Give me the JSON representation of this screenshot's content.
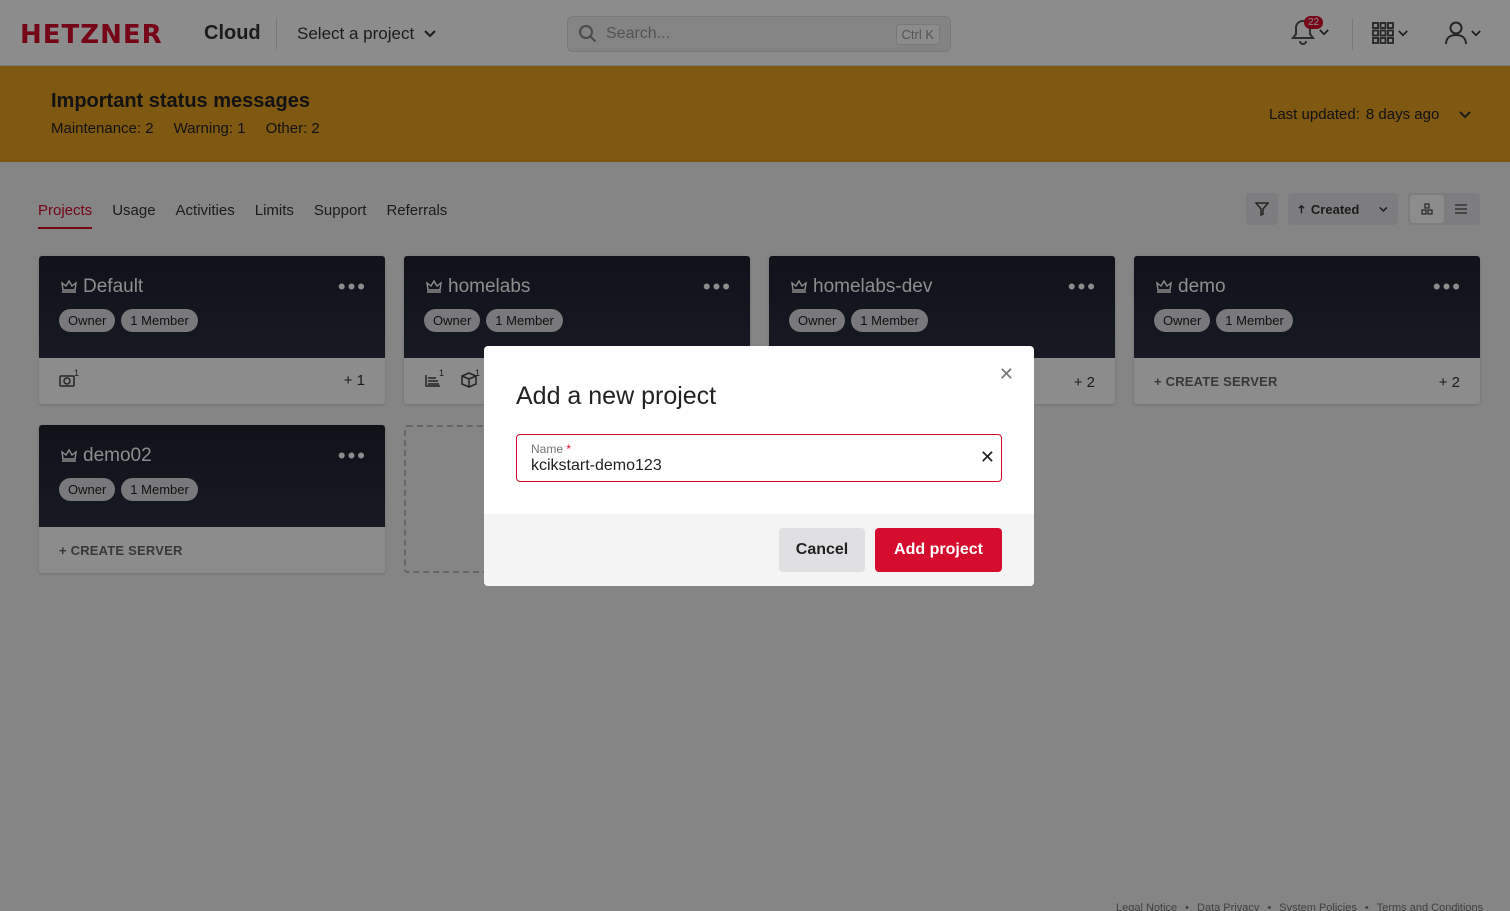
{
  "header": {
    "logo": "HETZNER",
    "product": "Cloud",
    "project_select": "Select a project",
    "search_placeholder": "Search...",
    "search_shortcut": "Ctrl K",
    "notifications_count": "22"
  },
  "banner": {
    "title": "Important status messages",
    "maintenance_label": "Maintenance:",
    "maintenance_value": "2",
    "warning_label": "Warning:",
    "warning_value": "1",
    "other_label": "Other:",
    "other_value": "2",
    "updated_label": "Last updated:",
    "updated_value": "8 days ago"
  },
  "tabs": [
    "Projects",
    "Usage",
    "Activities",
    "Limits",
    "Support",
    "Referrals"
  ],
  "toolbar": {
    "sort_label": "Created"
  },
  "projects": [
    {
      "name": "Default",
      "role": "Owner",
      "members": "1 Member",
      "plus": "+ 1",
      "res1": "1"
    },
    {
      "name": "homelabs",
      "role": "Owner",
      "members": "1 Member",
      "res1": "1",
      "res2": "1"
    },
    {
      "name": "homelabs-dev",
      "role": "Owner",
      "members": "1 Member",
      "plus": "+ 2"
    },
    {
      "name": "demo",
      "role": "Owner",
      "members": "1 Member",
      "create": "CREATE SERVER",
      "plus": "+ 2"
    },
    {
      "name": "demo02",
      "role": "Owner",
      "members": "1 Member",
      "create": "CREATE SERVER"
    }
  ],
  "modal": {
    "title": "Add a new project",
    "field_label": "Name",
    "required_mark": "*",
    "field_value": "kcikstart-demo123",
    "cancel": "Cancel",
    "submit": "Add project"
  },
  "footer": {
    "links": [
      "Legal Notice",
      "Data Privacy",
      "System Policies",
      "Terms and Conditions"
    ],
    "separator": "•"
  },
  "colors": {
    "brand": "#d50c2d",
    "banner": "#e8a020",
    "card_dark": "#1e2130"
  },
  "icons": [
    "search-icon",
    "chevron-down-icon",
    "bell-icon",
    "grid-apps-icon",
    "user-icon",
    "crown-icon",
    "more-icon",
    "filter-icon",
    "sort-up-icon",
    "tile-view-icon",
    "list-view-icon",
    "camera-icon",
    "volume-icon",
    "box-icon",
    "plus-icon",
    "close-icon"
  ]
}
